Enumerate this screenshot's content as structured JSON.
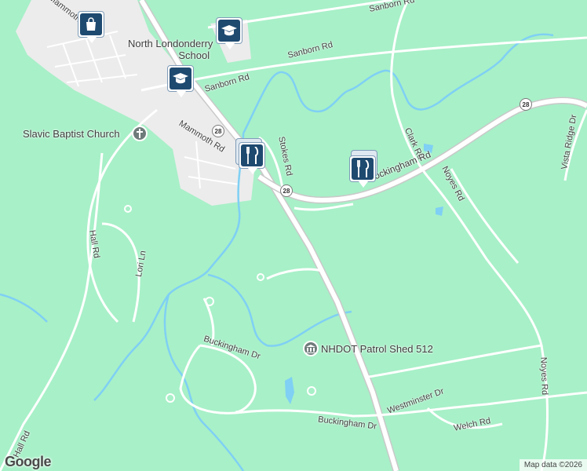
{
  "map": {
    "colors": {
      "land": "#a8f0c8",
      "developed": "#ececec",
      "water": "#7fd0f4",
      "road": "#ffffff",
      "highway": "#c9c9c9",
      "pin": "#1f4a70"
    },
    "roads": {
      "sanborn_rd_1": "Sanborn Rd",
      "sanborn_rd_2": "Sanborn Rd",
      "sanborn_rd_3": "Sanborn Rd",
      "mammoth_rd_1": "Mammoth Rd",
      "mammoth_rd_2": "Mammoth",
      "stokes_rd": "Stokes Rd",
      "clark_rd": "Clark Rd",
      "noyes_rd_1": "Noyes Rd",
      "noyes_rd_2": "Noyes Rd",
      "rockingham_rd": "Rockingham Rd",
      "vista_ridge_dr": "Vista Ridge Dr",
      "hall_rd_1": "Hall Rd",
      "hall_rd_2": "Hall Rd",
      "lori_ln": "Lori Ln",
      "buckingham_dr_1": "Buckingham Dr",
      "buckingham_dr_2": "Buckingham Dr",
      "westminster_dr": "Westminster Dr",
      "welch_rd": "Welch Rd"
    },
    "route_shields": [
      "28",
      "28",
      "28"
    ],
    "places": {
      "school_name": "North Londonderry School",
      "school_line1": "North Londonderry",
      "school_line2": "School",
      "church": "Slavic Baptist Church",
      "patrol_shed": "NHDOT Patrol Shed 512"
    },
    "markers": [
      {
        "type": "shopping",
        "icon": "shopping-bag-icon"
      },
      {
        "type": "school",
        "icon": "graduation-cap-icon"
      },
      {
        "type": "school",
        "icon": "graduation-cap-icon"
      },
      {
        "type": "restaurant",
        "icon": "fork-knife-icon"
      },
      {
        "type": "restaurant",
        "icon": "fork-knife-icon"
      }
    ],
    "logo": "Google",
    "attribution": "Map data ©2026"
  }
}
